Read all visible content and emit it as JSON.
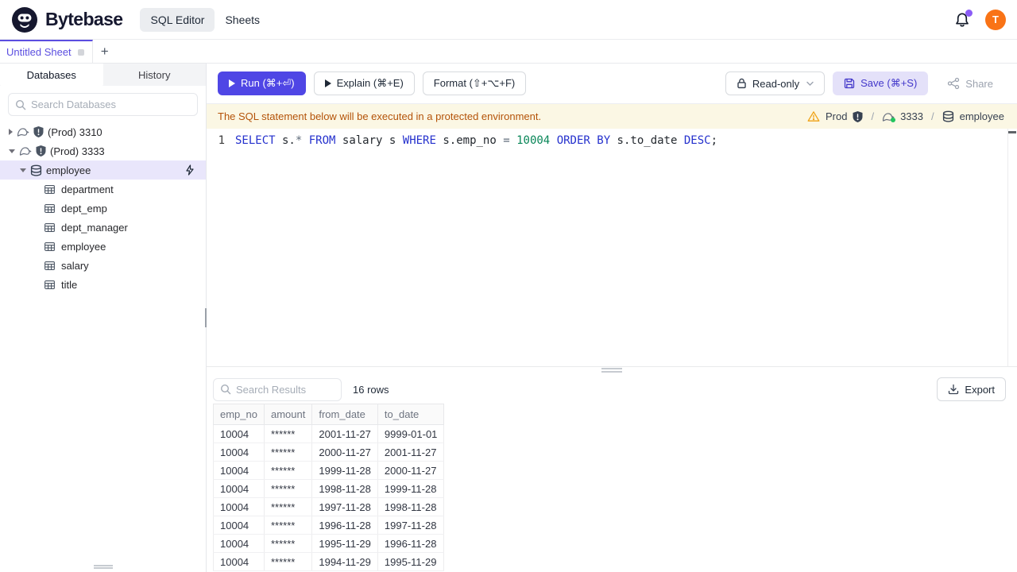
{
  "brand": {
    "name": "Bytebase"
  },
  "topnav": {
    "items": [
      {
        "label": "SQL Editor"
      },
      {
        "label": "Sheets"
      }
    ],
    "avatar_initial": "T"
  },
  "sheet_tabs": {
    "active_tab": "Untitled Sheet",
    "add_label": "+"
  },
  "sidebar": {
    "tabs": [
      {
        "label": "Databases"
      },
      {
        "label": "History"
      }
    ],
    "search_placeholder": "Search Databases",
    "instances": [
      {
        "label": "(Prod) 3310",
        "expanded": false
      },
      {
        "label": "(Prod) 3333",
        "expanded": true
      }
    ],
    "database": {
      "label": "employee",
      "selected": true
    },
    "tables": [
      "department",
      "dept_emp",
      "dept_manager",
      "employee",
      "salary",
      "title"
    ]
  },
  "toolbar": {
    "run_label": "Run (⌘+⏎)",
    "explain_label": "Explain (⌘+E)",
    "format_label": "Format (⇧+⌥+F)",
    "readonly_label": "Read-only",
    "save_label": "Save (⌘+S)",
    "share_label": "Share"
  },
  "banner": {
    "message": "The SQL statement below will be executed in a protected environment.",
    "environment": "Prod",
    "instance": "3333",
    "database": "employee",
    "separator": "/"
  },
  "editor": {
    "line_number": "1",
    "sql_text": "SELECT s.* FROM salary s WHERE s.emp_no = 10004 ORDER BY s.to_date DESC;",
    "tokens": [
      {
        "t": "SELECT",
        "c": "kw"
      },
      {
        "t": " s.",
        "c": "plain"
      },
      {
        "t": "*",
        "c": "op"
      },
      {
        "t": " ",
        "c": "plain"
      },
      {
        "t": "FROM",
        "c": "kw"
      },
      {
        "t": " salary s ",
        "c": "plain"
      },
      {
        "t": "WHERE",
        "c": "kw"
      },
      {
        "t": " s.emp_no ",
        "c": "plain"
      },
      {
        "t": "=",
        "c": "op"
      },
      {
        "t": " ",
        "c": "plain"
      },
      {
        "t": "10004",
        "c": "num"
      },
      {
        "t": " ",
        "c": "plain"
      },
      {
        "t": "ORDER BY",
        "c": "kw"
      },
      {
        "t": " s.to_date ",
        "c": "plain"
      },
      {
        "t": "DESC",
        "c": "kw"
      },
      {
        "t": ";",
        "c": "plain"
      }
    ]
  },
  "results": {
    "search_placeholder": "Search Results",
    "row_count": "16 rows",
    "export_label": "Export",
    "columns": [
      "emp_no",
      "amount",
      "from_date",
      "to_date"
    ],
    "rows": [
      [
        "10004",
        "******",
        "2001-11-27",
        "9999-01-01"
      ],
      [
        "10004",
        "******",
        "2000-11-27",
        "2001-11-27"
      ],
      [
        "10004",
        "******",
        "1999-11-28",
        "2000-11-27"
      ],
      [
        "10004",
        "******",
        "1998-11-28",
        "1999-11-28"
      ],
      [
        "10004",
        "******",
        "1997-11-28",
        "1998-11-28"
      ],
      [
        "10004",
        "******",
        "1996-11-28",
        "1997-11-28"
      ],
      [
        "10004",
        "******",
        "1995-11-29",
        "1996-11-28"
      ],
      [
        "10004",
        "******",
        "1994-11-29",
        "1995-11-29"
      ]
    ]
  },
  "colors": {
    "accent": "#4f46e5",
    "accent_soft_bg": "#e4e1f9",
    "tab_purple": "#5b4ee0",
    "warning_bg": "#fbf7e4",
    "warning_text": "#b45309",
    "sql_keyword": "#2531cd",
    "sql_number": "#098658",
    "avatar_bg": "#f97316",
    "notification_dot": "#8b5cf6",
    "selected_row_bg": "#e9e6fb"
  }
}
